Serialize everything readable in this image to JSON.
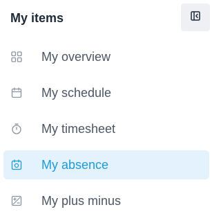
{
  "panel": {
    "title": "My items",
    "collapse_icon": "sidebar-collapse-icon"
  },
  "nav": {
    "items": [
      {
        "label": "My overview",
        "icon": "grid-icon",
        "active": false
      },
      {
        "label": "My schedule",
        "icon": "calendar-icon",
        "active": false
      },
      {
        "label": "My timesheet",
        "icon": "stopwatch-icon",
        "active": false
      },
      {
        "label": "My absence",
        "icon": "calendar-absence-icon",
        "active": true
      },
      {
        "label": "My plus minus",
        "icon": "plus-minus-icon",
        "active": false
      }
    ]
  },
  "colors": {
    "active_background": "#e3f2fd",
    "active_text": "#1e9bd7",
    "inactive_text": "#4b5563",
    "inactive_icon": "#8a939e",
    "title_text": "#1f2a37",
    "button_background": "#eef0f3"
  }
}
